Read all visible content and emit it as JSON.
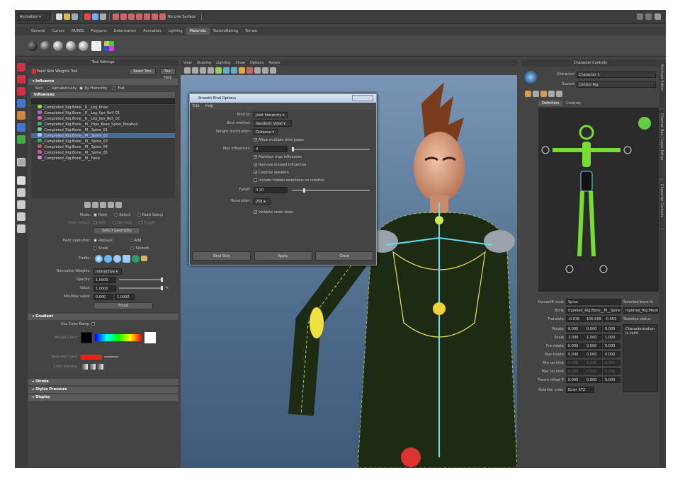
{
  "status_line": {
    "mode": "Animation",
    "no_live": "No Live Surface"
  },
  "shelf_tabs": [
    "General",
    "Curves",
    "NURBS",
    "Polygons",
    "Deformation",
    "Animation",
    "Lighting",
    "Materials",
    "TextureBaking",
    "Terrain"
  ],
  "shelf_active": "Materials",
  "tool_settings": {
    "title": "Tool Settings",
    "tool_name": "Paint Skin Weights Tool",
    "reset": "Reset Tool",
    "help": "Tool Help",
    "influence_header": "Influence",
    "sort_label": "Sort:",
    "sort_opts": [
      "Alphabetically",
      "By Hierarchy",
      "Flat"
    ],
    "influences_header": "Influences",
    "influences": [
      "_Completed_Rig:Bone__R__Leg_Knee",
      "_Completed_Rig:Bone__R__Leg_Upr_Roll_01",
      "_Completed_Rig:Bone__R__Leg_Upr_Roll_02",
      "_Completed_Rig:Bone__M__Hips_Base_Spine_Rotation",
      "_Completed_Rig:Bone__M__Spine_01",
      "_Completed_Rig:Bone__M__Spine_02",
      "_Completed_Rig:Bone__M__Spine_03",
      "_Completed_Rig:Bone__M__Spine_04",
      "_Completed_Rig:Bone__M__Spine_05",
      "_Completed_Rig:Bone__M__Neck"
    ],
    "selected_influence": "_Completed_Rig:Bone__M__Spine_02",
    "mode_label": "Mode:",
    "mode_opts": [
      "Paint",
      "Select",
      "Paint Select"
    ],
    "paint_select_label": "Paint Select:",
    "ps_opts": [
      "Add",
      "Remove",
      "Toggle"
    ],
    "select_geometry": "Select Geometry",
    "paint_op_label": "Paint operation:",
    "op_opts": [
      "Replace",
      "Add",
      "Scale",
      "Smooth"
    ],
    "profile_label": "Profile:",
    "norm_label": "Normalize Weights:",
    "norm_value": "Interactive",
    "opacity_label": "Opacity:",
    "opacity_value": "1.0000",
    "value_label": "Value:",
    "value_value": "1.0000",
    "minmax_label": "Min/Max value:",
    "min_value": "0.000",
    "max_value": "1.0000",
    "flood": "Flood",
    "gradient_header": "Gradient",
    "use_color_ramp": "Use Color Ramp",
    "weight_color": "Weight Color:",
    "selected_color": "Selected Color:",
    "color_presets": "Color presets:",
    "stroke": "Stroke",
    "stylus": "Stylus Pressure",
    "display": "Display"
  },
  "viewport": {
    "menu": [
      "View",
      "Shading",
      "Lighting",
      "Show",
      "Options",
      "Panels"
    ]
  },
  "dialog": {
    "title": "Smooth Bind Options",
    "menu": [
      "Edit",
      "Help"
    ],
    "bind_to_label": "Bind to:",
    "bind_to": "Joint hierarchy",
    "bind_method_label": "Bind method:",
    "bind_method": "Geodesic Voxel",
    "weight_dist_label": "Weight distribution:",
    "weight_dist": "Distance",
    "allow_multi": "Allow multiple bind poses",
    "max_inf_label": "Max influences:",
    "max_inf": "4",
    "maintain": "Maintain max influences",
    "remove_unused": "Remove unused influences",
    "colorize": "Colorize skeleton",
    "include_hidden": "Include hidden selections on creation",
    "falloff_label": "Falloff:",
    "falloff": "0.20",
    "resolution_label": "Resolution:",
    "resolution": "256",
    "validate": "Validate voxel state",
    "bind_skin": "Bind Skin",
    "apply": "Apply",
    "close": "Close"
  },
  "char_controls": {
    "title": "Character Controls",
    "character_label": "Character:",
    "character": "Character 1",
    "source_label": "Source:",
    "source": "Control Rig",
    "tabs": [
      "Definition",
      "Controls"
    ],
    "humanik_label": "HumanIK node",
    "humanik": "Spine",
    "selected_bone_label": "Selected bone in skeleton:",
    "bone_label": "Bone",
    "bone": "mpleted_Rig:Bone__M__Spine_01",
    "bone2": "mpleted_Rig:Mesh_M_Body",
    "translate_label": "Translate",
    "translate": [
      "-0.016",
      "106.999",
      "-0.663"
    ],
    "skel_status_label": "Skeleton status",
    "status_msg": "Characterization is valid.",
    "rows": [
      {
        "label": "Rotate",
        "v": [
          "0.000",
          "0.000",
          "0.000"
        ]
      },
      {
        "label": "Scale",
        "v": [
          "1.000",
          "1.000",
          "1.000"
        ]
      },
      {
        "label": "Pre-rotate",
        "v": [
          "0.000",
          "0.000",
          "0.000"
        ]
      },
      {
        "label": "Post-rotate",
        "v": [
          "0.000",
          "0.000",
          "0.000"
        ]
      },
      {
        "label": "Min rot limit",
        "v": [
          "0.000",
          "0.000",
          "0.000"
        ]
      },
      {
        "label": "Max rot limit",
        "v": [
          "0.000",
          "0.000",
          "0.000"
        ]
      },
      {
        "label": "Parent offset R",
        "v": [
          "0.000",
          "0.000",
          "0.000"
        ]
      }
    ],
    "rot_order_label": "Rotation order",
    "rot_order": "Euler XYZ"
  },
  "side_tabs": [
    "Attribute Editor",
    "Channel Box / Layer Editor",
    "Character Controls"
  ]
}
